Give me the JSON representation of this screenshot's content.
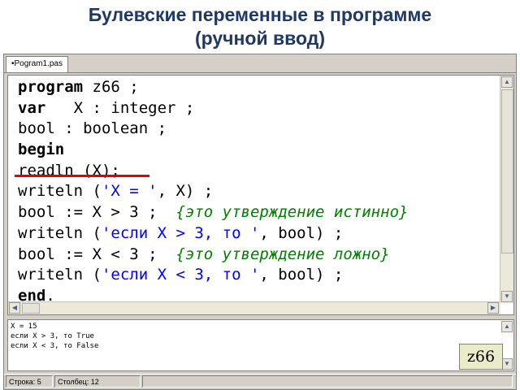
{
  "slide": {
    "title_line1": "Булевские переменные в программе",
    "title_line2": "(ручной ввод)"
  },
  "ide": {
    "tab_label": "•Pogram1.pas",
    "code_lines": [
      [
        {
          "t": "program",
          "k": "kw"
        },
        {
          "t": " z66 ;",
          "k": "plain"
        }
      ],
      [
        {
          "t": "var",
          "k": "kw"
        },
        {
          "t": "   X : integer ;",
          "k": "plain"
        }
      ],
      [
        {
          "t": "bool : boolean ;",
          "k": "plain"
        }
      ],
      [
        {
          "t": "begin",
          "k": "kw"
        }
      ],
      [
        {
          "t": "readln (X);",
          "k": "plain"
        }
      ],
      [
        {
          "t": "writeln (",
          "k": "plain"
        },
        {
          "t": "'X = '",
          "k": "str"
        },
        {
          "t": ", X) ;",
          "k": "plain"
        }
      ],
      [
        {
          "t": "bool := X > 3 ;  ",
          "k": "plain"
        },
        {
          "t": "{это утверждение истинно}",
          "k": "com"
        }
      ],
      [
        {
          "t": "writeln (",
          "k": "plain"
        },
        {
          "t": "'если X > 3, то '",
          "k": "str"
        },
        {
          "t": ", bool) ;",
          "k": "plain"
        }
      ],
      [
        {
          "t": "bool := X < 3 ;  ",
          "k": "plain"
        },
        {
          "t": "{это утверждение ложно}",
          "k": "com"
        }
      ],
      [
        {
          "t": "writeln (",
          "k": "plain"
        },
        {
          "t": "'если X < 3, то '",
          "k": "str"
        },
        {
          "t": ", bool) ;",
          "k": "plain"
        }
      ],
      [
        {
          "t": "end",
          "k": "kw"
        },
        {
          "t": ".",
          "k": "plain"
        }
      ]
    ],
    "output_lines": [
      "X = 15",
      "если X > 3, то True",
      "если X < 3, то False"
    ],
    "badge": "z66",
    "status": {
      "row": "Строка: 5",
      "col": "Столбец: 12"
    },
    "icons": {
      "scroll_up": "▲",
      "scroll_down": "▼",
      "scroll_left": "◀",
      "scroll_right": "▶"
    },
    "colors": {
      "keyword": "#000000",
      "string": "#0000ff",
      "comment": "#008000",
      "underline": "#e00000",
      "title": "#1f3864"
    }
  }
}
